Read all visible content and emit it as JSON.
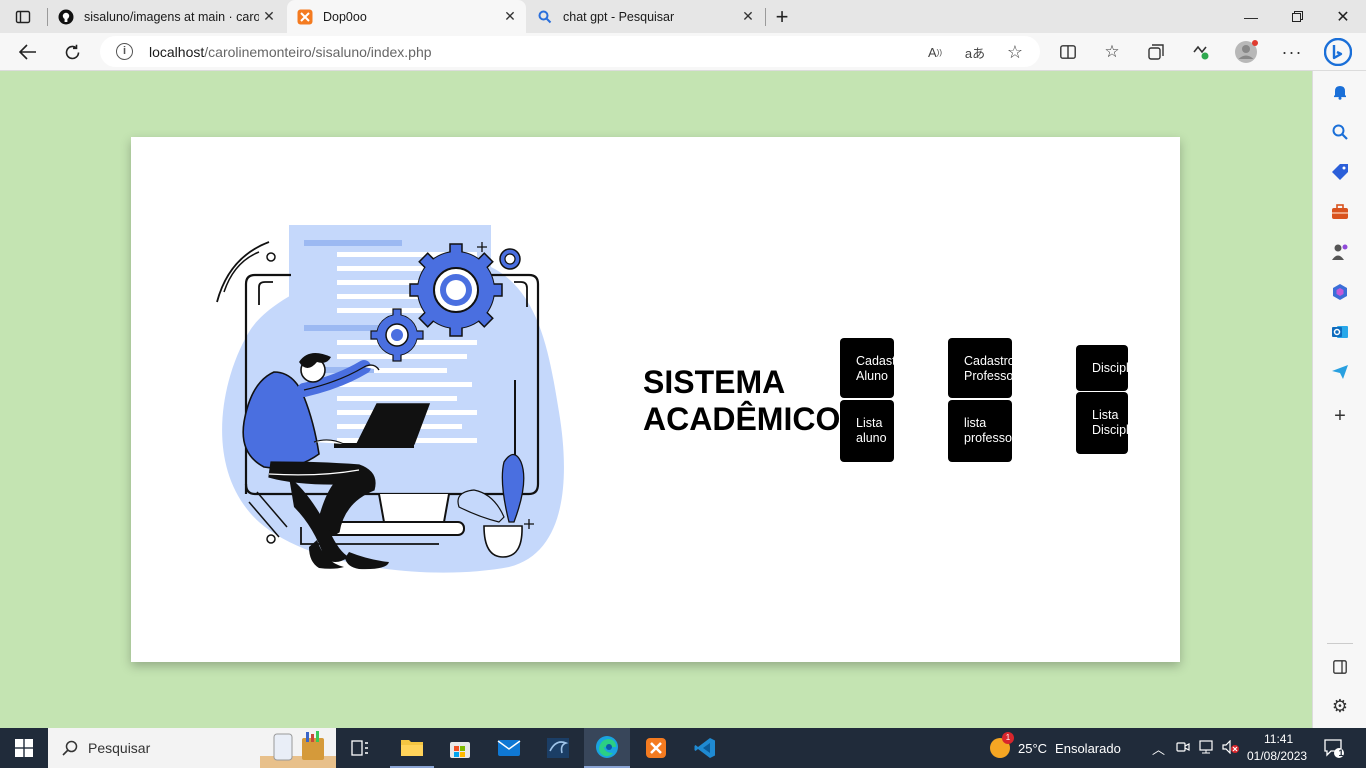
{
  "browser": {
    "tabs": [
      {
        "title": "sisaluno/imagens at main · carolin",
        "favicon": "github-icon",
        "active": false
      },
      {
        "title": "Dop0oo",
        "favicon": "xampp-icon",
        "active": true
      },
      {
        "title": "chat gpt - Pesquisar",
        "favicon": "search-icon",
        "active": false
      }
    ],
    "new_tab_label": "+",
    "address": {
      "host": "localhost",
      "path": "/carolinemonteiro/sisaluno/index.php"
    }
  },
  "page": {
    "title": "SISTEMA\nACADÊMICO",
    "buttons": {
      "cadastro_aluno": "Cadastro\nAluno",
      "lista_aluno": "Lista\naluno",
      "cadastro_professor": "Cadastro\nProfessor",
      "lista_professor": " lista\nprofessor",
      "disciplina": "Disciplina",
      "lista_disciplina": "Lista\nDisciplina"
    }
  },
  "taskbar": {
    "search_label": "Pesquisar",
    "weather": {
      "temp": "25°C",
      "condition": "Ensolarado",
      "badge": "1"
    },
    "time": "11:41",
    "date": "01/08/2023",
    "notification_count": "1"
  },
  "colors": {
    "page_background": "#c4e4b2",
    "card": "#ffffff",
    "button": "#000000",
    "illustration_blue": "#4a6fe0",
    "illustration_light": "#c5d8fb"
  }
}
